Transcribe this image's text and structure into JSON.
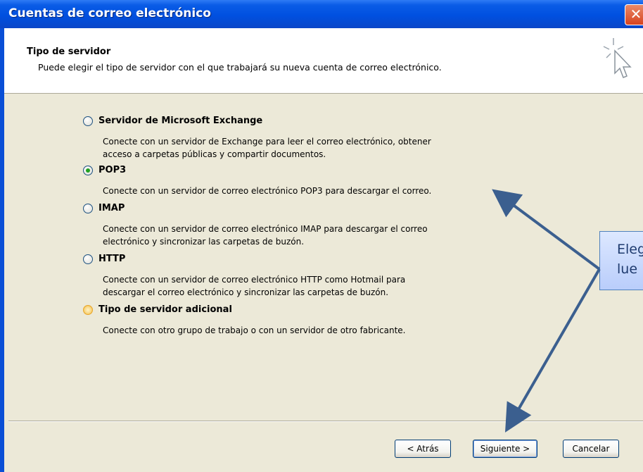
{
  "window": {
    "title": "Cuentas de correo electrónico",
    "close_glyph": "✕"
  },
  "header": {
    "title": "Tipo de servidor",
    "description": "Puede elegir el tipo de servidor con el que trabajará su nueva cuenta de correo electrónico."
  },
  "options": [
    {
      "label": "Servidor de Microsoft Exchange",
      "selected": false,
      "desc": [
        "Conecte con un servidor de Exchange para leer el correo electrónico, obtener",
        "acceso a carpetas públicas y compartir documentos."
      ]
    },
    {
      "label": "POP3",
      "selected": true,
      "desc": [
        "Conecte con un servidor de correo electrónico POP3 para descargar el correo."
      ]
    },
    {
      "label": "IMAP",
      "selected": false,
      "desc": [
        "Conecte con un servidor de correo electrónico IMAP para descargar el correo",
        "electrónico y sincronizar las carpetas de buzón."
      ]
    },
    {
      "label": "HTTP",
      "selected": false,
      "desc": [
        "Conecte con un servidor de correo electrónico HTTP como Hotmail para",
        "descargar el correo electrónico y sincronizar las carpetas de buzón."
      ]
    },
    {
      "label": "Tipo de servidor adicional",
      "selected": false,
      "desc": [
        "Conecte con otro grupo de trabajo o con un servidor de otro fabricante."
      ]
    }
  ],
  "buttons": {
    "back": "< Atrás",
    "next": "Siguiente >",
    "cancel": "Cancelar"
  },
  "callout": {
    "line1": "Eleg",
    "line2": "lue"
  },
  "colors": {
    "titlebar": "#0050e0",
    "callout_fill": "#c6d9f1",
    "arrow": "#3b5f8f",
    "selected_radio": "#21a121"
  }
}
